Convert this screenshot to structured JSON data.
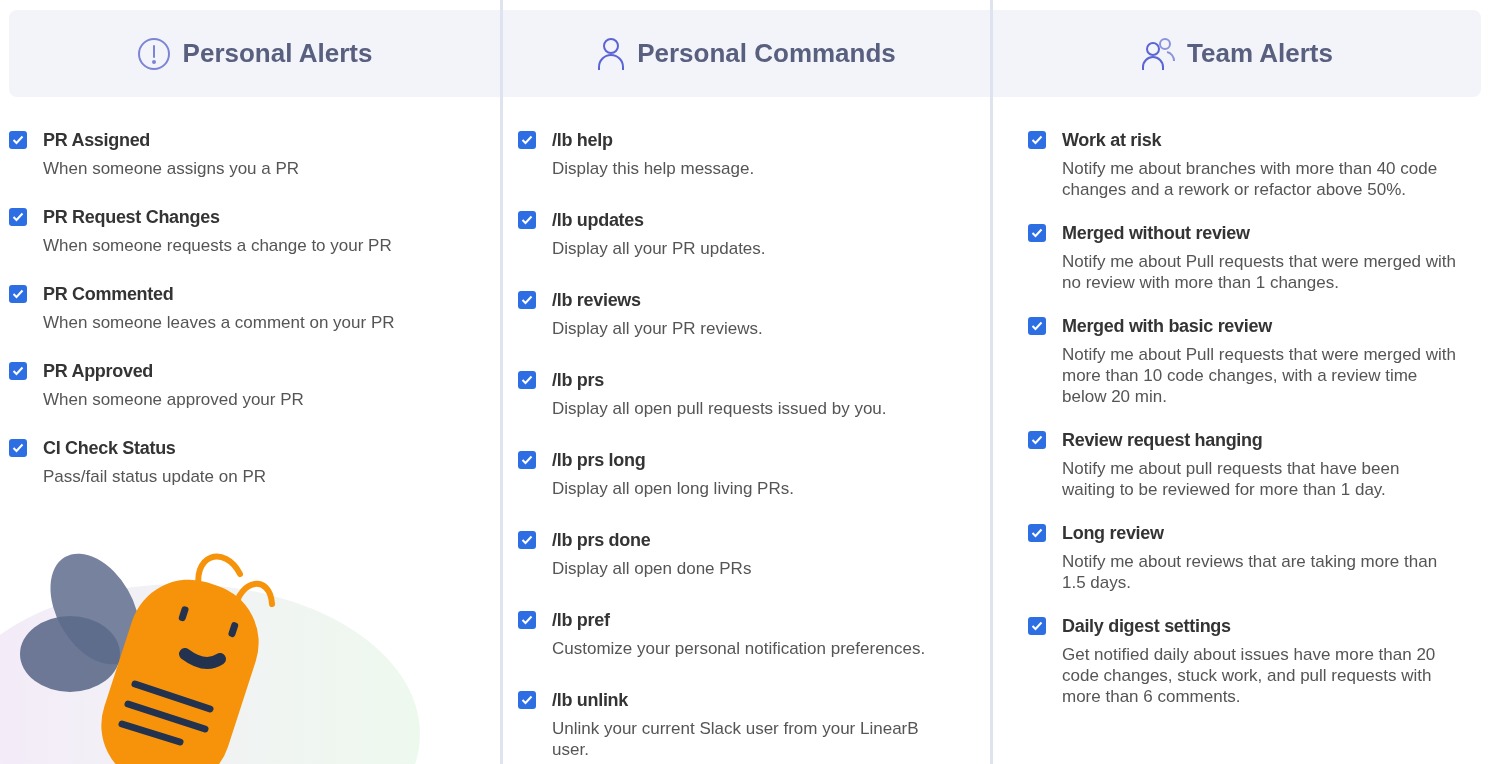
{
  "columns": [
    {
      "title": "Personal Alerts",
      "kind": "alert",
      "items": [
        {
          "title": "PR Assigned",
          "description": "When someone assigns you a PR",
          "checked": true
        },
        {
          "title": "PR Request Changes",
          "description": "When someone requests a change to your PR",
          "checked": true
        },
        {
          "title": "PR Commented",
          "description": "When someone leaves a comment on your PR",
          "checked": true
        },
        {
          "title": "PR Approved",
          "description": "When someone approved your PR",
          "checked": true
        },
        {
          "title": "CI Check Status",
          "description": "Pass/fail status update on PR",
          "checked": true
        }
      ]
    },
    {
      "title": "Personal Commands",
      "kind": "user",
      "items": [
        {
          "title": "/lb help",
          "description": "Display this help message.",
          "checked": true
        },
        {
          "title": "/lb updates",
          "description": "Display all your PR updates.",
          "checked": true
        },
        {
          "title": "/lb reviews",
          "description": "Display all your PR reviews.",
          "checked": true
        },
        {
          "title": "/lb prs",
          "description": "Display all open pull requests issued by you.",
          "checked": true
        },
        {
          "title": "/lb prs long",
          "description": "Display all open long living PRs.",
          "checked": true
        },
        {
          "title": "/lb prs done",
          "description": "Display all open done PRs",
          "checked": true
        },
        {
          "title": "/lb pref",
          "description": "Customize your personal notification preferences.",
          "checked": true
        },
        {
          "title": "/lb unlink",
          "description": "Unlink your current Slack user from your LinearB user.",
          "checked": true
        }
      ]
    },
    {
      "title": "Team Alerts",
      "kind": "team",
      "items": [
        {
          "title": "Work at risk",
          "description": "Notify me about branches with more than 40 code changes and a rework or refactor above 50%.",
          "checked": true
        },
        {
          "title": "Merged without review",
          "description": "Notify me about Pull requests that were merged with no review with more than 1 changes.",
          "checked": true
        },
        {
          "title": "Merged with basic review",
          "description": "Notify me about Pull requests that were merged with more than 10 code changes, with a review time below 20 min.",
          "checked": true
        },
        {
          "title": "Review request hanging",
          "description": "Notify me about pull requests that have been waiting to be reviewed for more than 1 day.",
          "checked": true
        },
        {
          "title": "Long review",
          "description": "Notify me about reviews that are taking more than 1.5 days.",
          "checked": true
        },
        {
          "title": "Daily digest settings",
          "description": "Get notified daily about issues have more than 20 code changes, stuck work, and pull requests with more than 6 comments.",
          "checked": true
        }
      ]
    }
  ]
}
